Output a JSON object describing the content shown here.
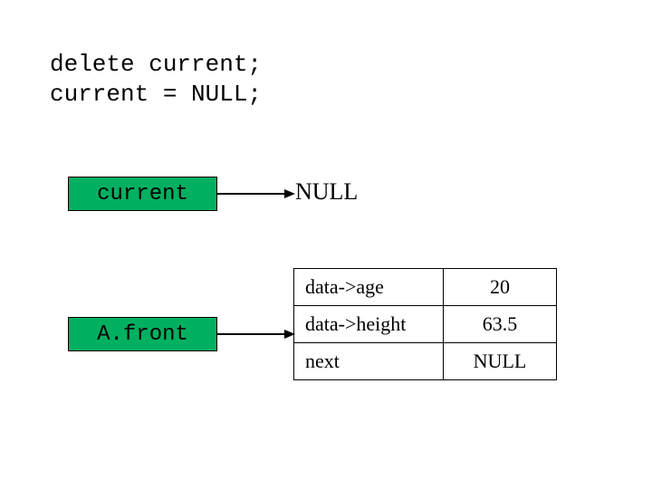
{
  "code": {
    "line1": "delete current;",
    "line2": "current = NULL;"
  },
  "boxes": {
    "current": "current",
    "afront": "A.front"
  },
  "null_label": "NULL",
  "node": {
    "rows": [
      {
        "label": "data->age",
        "value": "20"
      },
      {
        "label": "data->height",
        "value": "63.5"
      },
      {
        "label": "next",
        "value": "NULL"
      }
    ]
  }
}
